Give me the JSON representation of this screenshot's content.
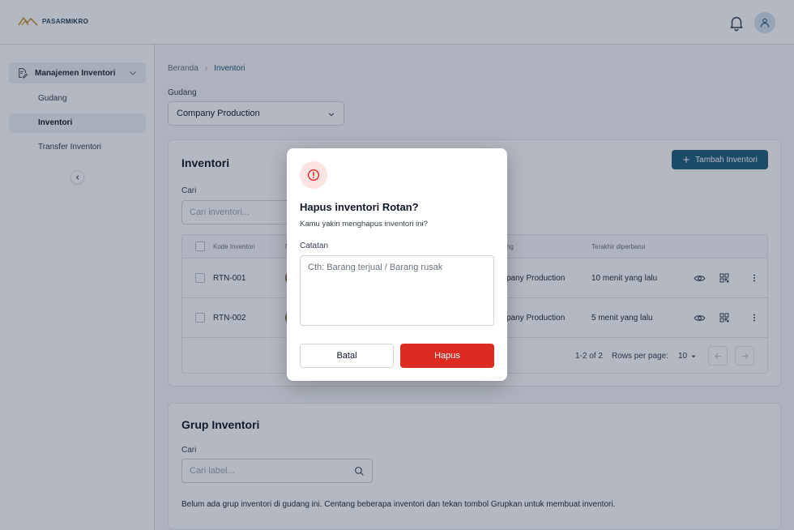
{
  "brand": {
    "name_prefix": "PASAR",
    "name_suffix": "MIKRO"
  },
  "header": {
    "notifications_icon": "bell-icon",
    "profile_icon": "user-icon"
  },
  "sidebar": {
    "group_label": "Manajemen Inventori",
    "items": [
      {
        "label": "Gudang"
      },
      {
        "label": "Inventori"
      },
      {
        "label": "Transfer Inventori"
      }
    ],
    "active_item": "Inventori"
  },
  "breadcrumb": {
    "home": "Beranda",
    "current": "Inventori"
  },
  "warehouse": {
    "label": "Gudang",
    "value": "Company Production"
  },
  "inventory_card": {
    "title": "Inventori",
    "add_button": "Tambah Inventori",
    "search_label": "Cari",
    "search_placeholder": "Cari inventori...",
    "columns": {
      "code": "Kode Inventori",
      "name": "N",
      "warehouse": "ng",
      "updated": "Terakhir diperbarui"
    },
    "rows": [
      {
        "code": "RTN-001",
        "warehouse": "pany Production",
        "updated": "10 menit yang lalu"
      },
      {
        "code": "RTN-002",
        "warehouse": "pany Production",
        "updated": "5 menit yang lalu"
      }
    ],
    "pagination": {
      "range": "1-2 of 2",
      "rows_label": "Rows per page:",
      "rows_value": "10"
    }
  },
  "group_card": {
    "title": "Grup Inventori",
    "search_label": "Cari",
    "search_placeholder": "Cari label...",
    "empty_note": "Belum ada grup inventori di gudang ini. Centang beberapa inventori dan tekan tombol Grupkan untuk membuat inventori."
  },
  "modal": {
    "icon": "alert-circle-icon",
    "title": "Hapus inventori Rotan?",
    "description": "Kamu yakin menghapus inventori ini?",
    "note_label": "Catatan",
    "note_placeholder": "Cth: Barang terjual / Barang rusak",
    "cancel_label": "Batal",
    "confirm_label": "Hapus"
  },
  "colors": {
    "primary": "#1f5e7e",
    "danger": "#dc2b22",
    "overlay": "rgba(22,33,62,0.32)"
  }
}
